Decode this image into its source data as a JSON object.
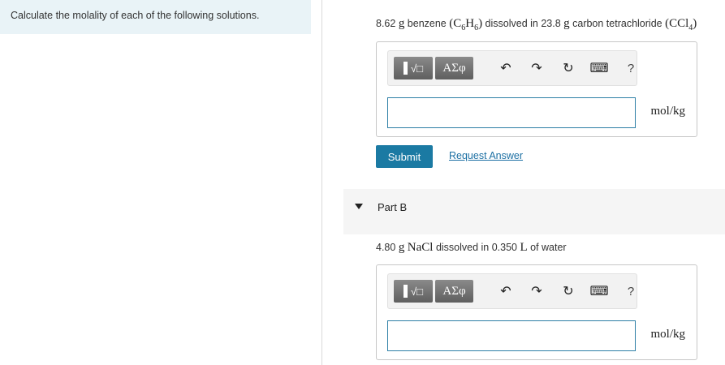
{
  "instructions": {
    "text": "Calculate the molality of each of the following solutions."
  },
  "partA": {
    "q_pre": "8.62 ",
    "q_g1": "g",
    "q_mid1": " benzene ",
    "q_formula1_a": "(C",
    "q_formula1_s1": "6",
    "q_formula1_b": "H",
    "q_formula1_s2": "6",
    "q_formula1_c": ")",
    "q_mid2": " dissolved in 23.8 ",
    "q_g2": "g",
    "q_mid3": " carbon tetrachloride ",
    "q_formula2_a": "(CCl",
    "q_formula2_s1": "4",
    "q_formula2_b": ")",
    "unit": "mol/kg",
    "input_value": "",
    "submit_label": "Submit",
    "request_label": "Request Answer"
  },
  "toolbar": {
    "greek_label": "ΑΣφ",
    "sqrt_label": "√□",
    "undo_glyph": "↶",
    "redo_glyph": "↷",
    "reset_glyph": "↻",
    "keyboard_glyph": "⌨",
    "help_label": "?"
  },
  "partB": {
    "title": "Part B",
    "q_pre": "4.80 ",
    "q_g": "g",
    "q_sp1": " ",
    "q_nacl": "NaCl",
    "q_mid": " dissolved in 0.350 ",
    "q_L": "L",
    "q_end": " of water",
    "unit": "mol/kg",
    "input_value": ""
  }
}
